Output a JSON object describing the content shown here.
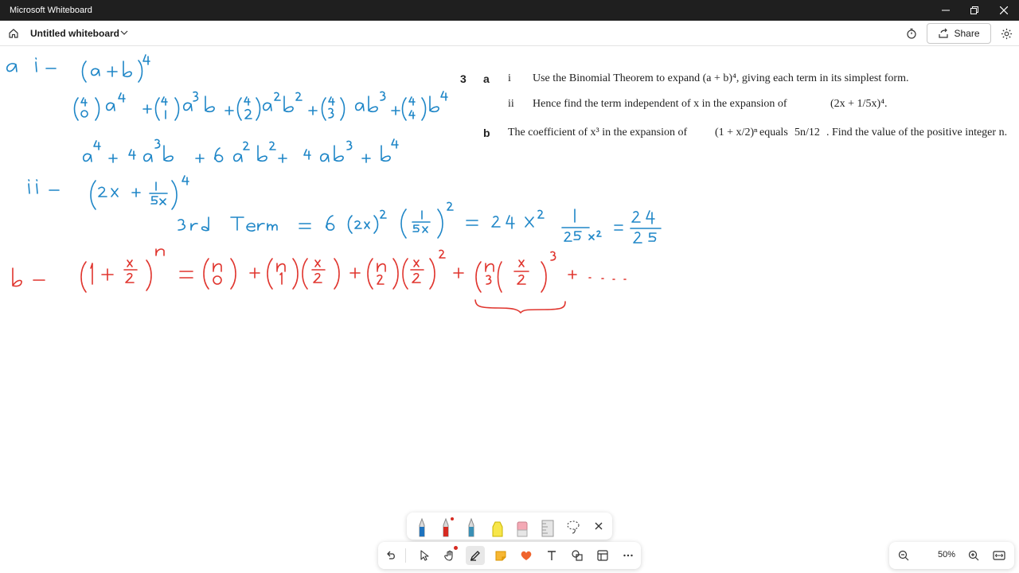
{
  "window": {
    "title": "Microsoft Whiteboard"
  },
  "header": {
    "doc_title": "Untitled whiteboard",
    "share_label": "Share"
  },
  "question": {
    "number": "3",
    "part_a": "a",
    "part_i": "i",
    "line_i": "Use the Binomial Theorem to expand (a + b)⁴, giving each term in its simplest form.",
    "part_ii": "ii",
    "line_ii_pre": "Hence find the term independent of x in the expansion of",
    "line_ii_expr": "(2x + 1/5x)⁴.",
    "part_b": "b",
    "line_b_pre": "The coefficient of x³ in the expansion of",
    "line_b_expr": "(1 + x/2)ⁿ",
    "line_b_mid": "equals",
    "line_b_frac": "5n/12",
    "line_b_post": ". Find the value of the positive integer n."
  },
  "notes": {
    "a_i_label": "a  i –",
    "a_i_expr": "(a+b)⁴",
    "a_i_expansion": "(⁴₀)a⁴ + (⁴₁)a³b + (⁴₂)a²b² + (⁴₃)ab³ + (⁴₄)b⁴",
    "a_i_result": "a⁴ + 4a³b + 6a²b² + 4ab³ + b⁴",
    "a_ii_label": "ii –",
    "a_ii_expr": "(2x + 1/5x)⁴",
    "a_ii_term": "3rd Term = 6 (2x)² (1/5x)² = 24 x² · 1/25x² = 24/25",
    "b_label": "b –",
    "b_expansion": "(1 + x/2)ⁿ = (ⁿ₀) + (ⁿ₁)(x/2) + (ⁿ₂)(x/2)² + (ⁿ₃)(x/2)³ + . . ."
  },
  "ink_colors": {
    "blue": "#1e86c7",
    "red": "#e0352e"
  },
  "toolbar": {
    "pens": [
      "blue-pen",
      "red-pen",
      "teal-pen",
      "yellow-highlighter",
      "eraser",
      "ruler",
      "lasso",
      "close"
    ],
    "tools": [
      "undo",
      "select",
      "pan",
      "ink",
      "sticky-note",
      "reactions",
      "text",
      "shapes",
      "templates",
      "more"
    ]
  },
  "zoom": {
    "level": "50%"
  }
}
